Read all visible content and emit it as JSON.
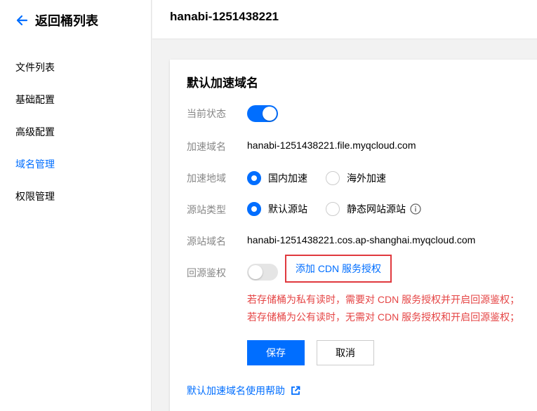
{
  "sidebar": {
    "back_label": "返回桶列表",
    "items": [
      {
        "label": "文件列表",
        "active": false
      },
      {
        "label": "基础配置",
        "active": false
      },
      {
        "label": "高级配置",
        "active": false
      },
      {
        "label": "域名管理",
        "active": true
      },
      {
        "label": "权限管理",
        "active": false
      }
    ]
  },
  "header": {
    "bucket_name": "hanabi-1251438221"
  },
  "card": {
    "title": "默认加速域名",
    "status": {
      "label": "当前状态",
      "enabled": true
    },
    "domain": {
      "label": "加速域名",
      "value": "hanabi-1251438221.file.myqcloud.com"
    },
    "region": {
      "label": "加速地域",
      "options": [
        {
          "label": "国内加速",
          "checked": true
        },
        {
          "label": "海外加速",
          "checked": false
        }
      ]
    },
    "origin_type": {
      "label": "源站类型",
      "options": [
        {
          "label": "默认源站",
          "checked": true
        },
        {
          "label": "静态网站源站",
          "checked": false
        }
      ],
      "info_icon": "info-icon"
    },
    "origin_domain": {
      "label": "源站域名",
      "value": "hanabi-1251438221.cos.ap-shanghai.myqcloud.com"
    },
    "auth": {
      "label": "回源鉴权",
      "enabled": false,
      "link": "添加 CDN 服务授权"
    },
    "warnings": [
      "若存储桶为私有读时，需要对 CDN 服务授权并开启回源鉴权；",
      "若存储桶为公有读时，无需对 CDN 服务授权和开启回源鉴权；"
    ],
    "save_label": "保存",
    "cancel_label": "取消",
    "help_label": "默认加速域名使用帮助"
  },
  "colors": {
    "accent": "#006eff",
    "warning": "#e54545",
    "highlight_border": "#e0393e"
  }
}
